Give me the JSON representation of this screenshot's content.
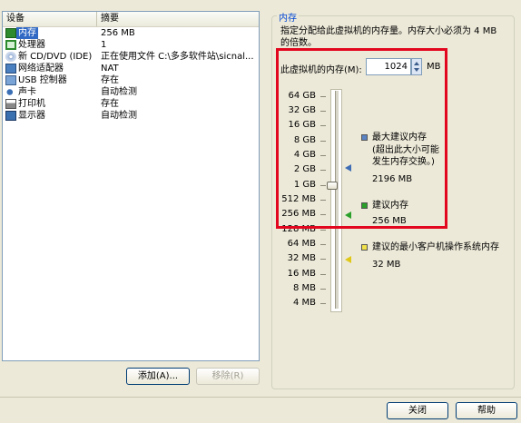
{
  "device_list": {
    "headers": {
      "device": "设备",
      "summary": "摘要"
    },
    "rows": [
      {
        "name": "内存",
        "value": "256 MB",
        "icon": "memory-icon",
        "selected": true
      },
      {
        "name": "处理器",
        "value": "1",
        "icon": "cpu-icon"
      },
      {
        "name": "新 CD/DVD (IDE)",
        "value": "正在使用文件 C:\\多多软件站\\sicnal...",
        "icon": "cd-icon"
      },
      {
        "name": "网络适配器",
        "value": "NAT",
        "icon": "network-icon"
      },
      {
        "name": "USB 控制器",
        "value": "存在",
        "icon": "usb-icon"
      },
      {
        "name": "声卡",
        "value": "自动检测",
        "icon": "sound-icon"
      },
      {
        "name": "打印机",
        "value": "存在",
        "icon": "printer-icon"
      },
      {
        "name": "显示器",
        "value": "自动检测",
        "icon": "display-icon"
      }
    ],
    "add_button": "添加(A)...",
    "remove_button": "移除(R)"
  },
  "memory": {
    "group_title": "内存",
    "description": "指定分配给此虚拟机的内存量。内存大小必须为 4 MB 的倍数。",
    "input_label": "此虚拟机的内存(M):",
    "value": "1024",
    "unit": "MB",
    "ticks": [
      "64 GB",
      "32 GB",
      "16 GB",
      "8 GB",
      "4 GB",
      "2 GB",
      "1 GB",
      "512 MB",
      "256 MB",
      "128 MB",
      "64 MB",
      "32 MB",
      "16 MB",
      "8 MB",
      "4 MB"
    ],
    "legend": {
      "max_recommended": {
        "title": "最大建议内存",
        "note": "(超出此大小可能发生内存交换。)",
        "value": "2196 MB",
        "color": "#5b84c4"
      },
      "recommended": {
        "title": "建议内存",
        "value": "256 MB",
        "color": "#2aa02a"
      },
      "min_guest": {
        "title": "建议的最小客户机操作系统内存",
        "value": "32 MB",
        "color": "#f1e14a"
      }
    }
  },
  "footer": {
    "close_button": "关闭",
    "help_button": "帮助"
  },
  "highlight_color": "#e2071e"
}
